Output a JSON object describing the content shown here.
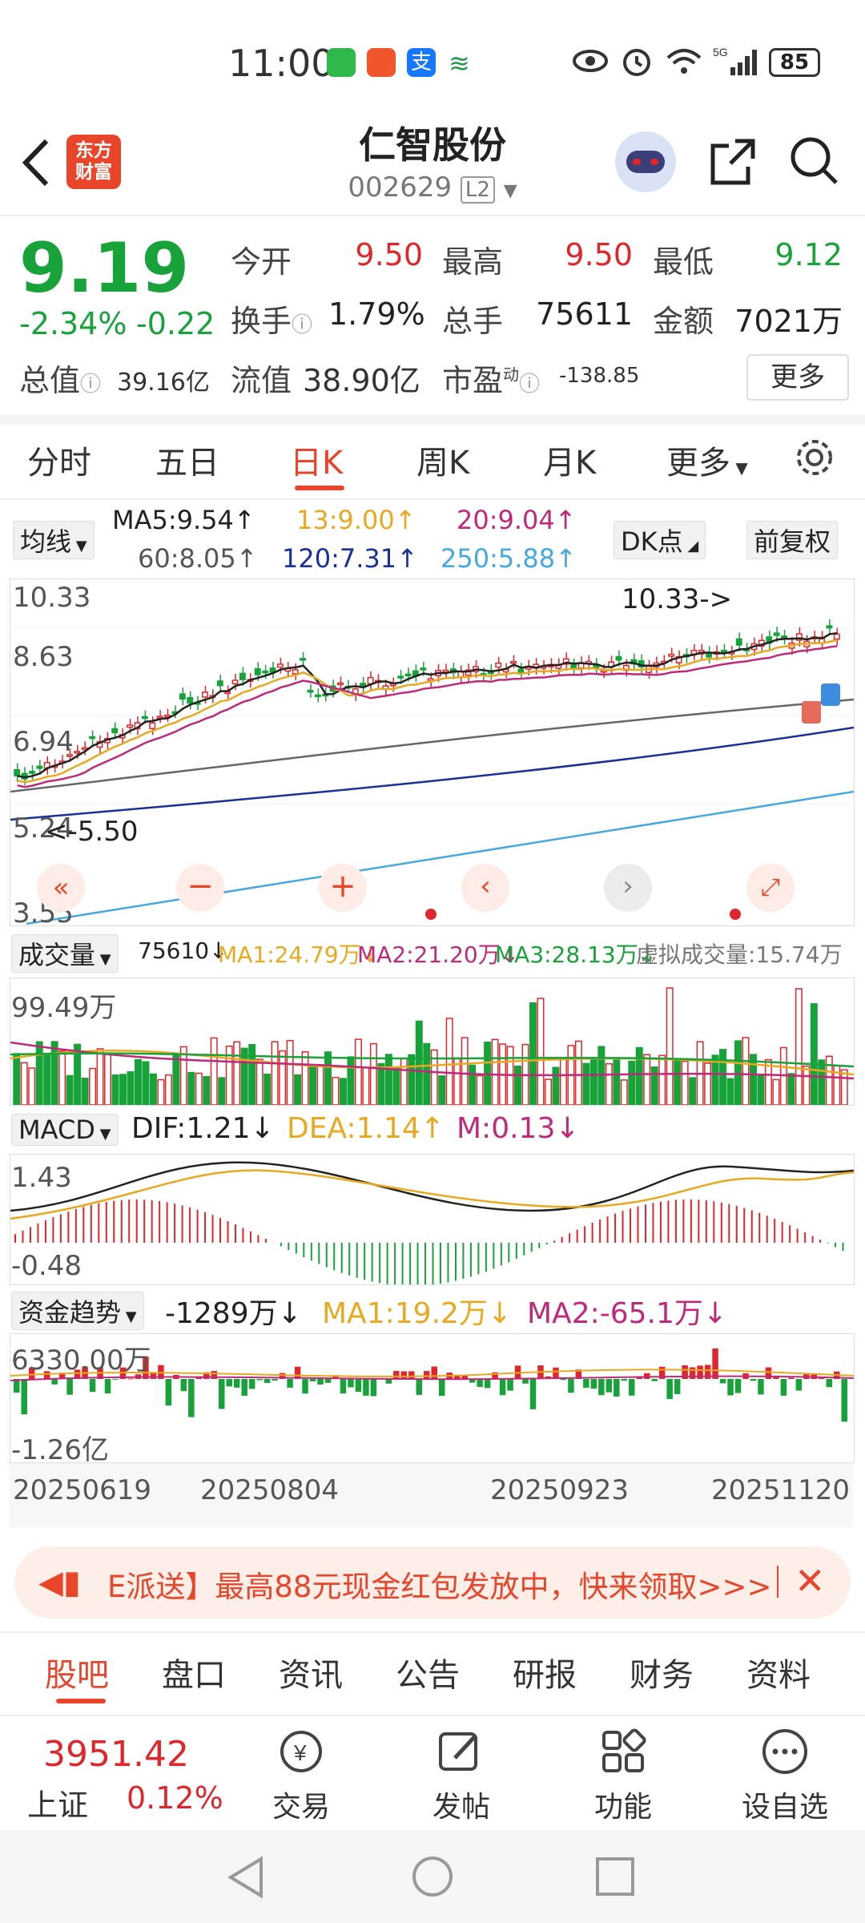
{
  "status": {
    "time": "11:00",
    "battery": "85"
  },
  "header": {
    "title": "仁智股份",
    "code": "002629",
    "level": "L2",
    "logo_line1": "东方",
    "logo_line2": "财富"
  },
  "quote": {
    "price": "9.19",
    "change_pct": "-2.34%",
    "change": "-0.22",
    "open_label": "今开",
    "open": "9.50",
    "high_label": "最高",
    "high": "9.50",
    "low_label": "最低",
    "low": "9.12",
    "turnover_label": "换手",
    "turnover": "1.79%",
    "volume_label": "总手",
    "volume": "75611",
    "amount_label": "金额",
    "amount": "7021万",
    "mcap_label": "总值",
    "mcap": "39.16亿",
    "float_label": "流值",
    "float": "38.90亿",
    "pe_label": "市盈",
    "pe_sup": "动",
    "pe": "-138.85",
    "more": "更多"
  },
  "ktabs": [
    "分时",
    "五日",
    "日K",
    "周K",
    "月K",
    "更多"
  ],
  "ma": {
    "selector": "均线",
    "ma5": "MA5:9.54↑",
    "ma13": "13:9.00↑",
    "ma20": "20:9.04↑",
    "ma60": "60:8.05↑",
    "ma120": "120:7.31↑",
    "ma250": "250:5.88↑",
    "dk": "DK点",
    "adjust": "前复权"
  },
  "price_axis": [
    "10.33",
    "8.63",
    "6.94",
    "5.24",
    "3.55"
  ],
  "price_annotations": {
    "high": "10.33->",
    "low": "<-5.50"
  },
  "volume": {
    "selector": "成交量",
    "value": "75610↓",
    "ma1": "MA1:24.79万↓",
    "ma2": "MA2:21.20万↓",
    "ma3": "MA3:28.13万↓",
    "virtual": "虚拟成交量:15.74万",
    "axis_top": "99.49万"
  },
  "macd": {
    "selector": "MACD",
    "dif": "DIF:1.21↓",
    "dea": "DEA:1.14↑",
    "m": "M:0.13↓",
    "axis_top": "1.43",
    "axis_bottom": "-0.48"
  },
  "fund": {
    "selector": "资金趋势",
    "value": "-1289万↓",
    "ma1": "MA1:19.2万↓",
    "ma2": "MA2:-65.1万↓",
    "axis_top": "6330.00万",
    "axis_bottom": "-1.26亿"
  },
  "dates": [
    "20250619",
    "20250804",
    "20250923",
    "20251120"
  ],
  "banner": {
    "text": "E派送】最高88元现金红包发放中，快来领取>>>"
  },
  "bottom_tabs": [
    "股吧",
    "盘口",
    "资讯",
    "公告",
    "研报",
    "财务",
    "资料"
  ],
  "nav": {
    "index_value": "3951.42",
    "index_name": "上证",
    "index_pct": "0.12%",
    "trade": "交易",
    "post": "发帖",
    "func": "功能",
    "watch": "设自选"
  },
  "colors": {
    "up": "#e0262a",
    "down": "#17a23a",
    "accent": "#e8452a"
  }
}
